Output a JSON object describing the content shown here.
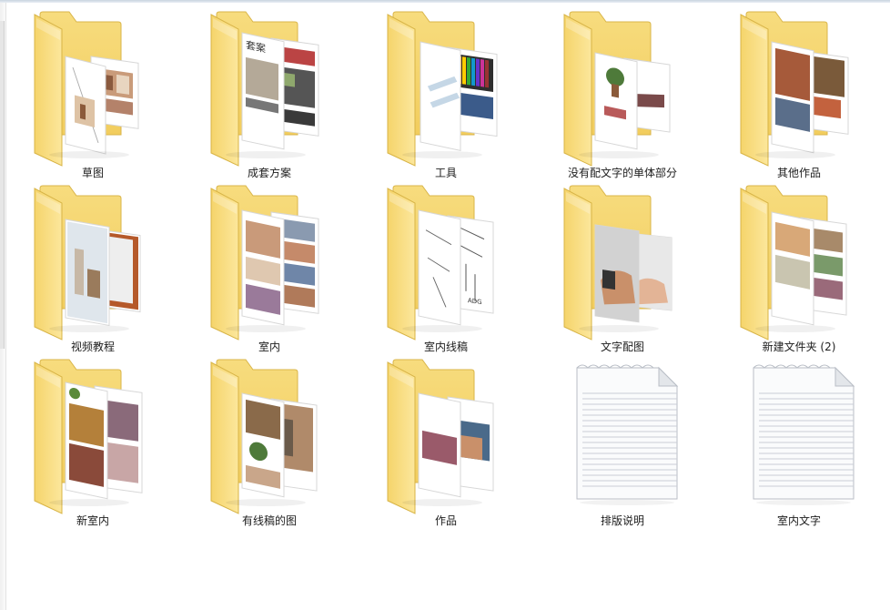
{
  "items": [
    {
      "name": "草图",
      "type": "folder",
      "thumb": "sketch"
    },
    {
      "name": "成套方案",
      "type": "folder",
      "thumb": "book"
    },
    {
      "name": "工具",
      "type": "folder",
      "thumb": "markers"
    },
    {
      "name": "没有配文字的单体部分",
      "type": "folder",
      "thumb": "furniture"
    },
    {
      "name": "其他作品",
      "type": "folder",
      "thumb": "color"
    },
    {
      "name": "视频教程",
      "type": "folder",
      "thumb": "video"
    },
    {
      "name": "室内",
      "type": "folder",
      "thumb": "interior"
    },
    {
      "name": "室内线稿",
      "type": "folder",
      "thumb": "lineart"
    },
    {
      "name": "文字配图",
      "type": "folder",
      "thumb": "hand"
    },
    {
      "name": "新建文件夹 (2)",
      "type": "folder",
      "thumb": "color2"
    },
    {
      "name": "新室内",
      "type": "folder",
      "thumb": "newinterior"
    },
    {
      "name": "有线稿的图",
      "type": "folder",
      "thumb": "wireimg"
    },
    {
      "name": "作品",
      "type": "folder",
      "thumb": "works"
    },
    {
      "name": "排版说明",
      "type": "textfile",
      "thumb": "txt"
    },
    {
      "name": "室内文字",
      "type": "textfile",
      "thumb": "txt"
    }
  ]
}
